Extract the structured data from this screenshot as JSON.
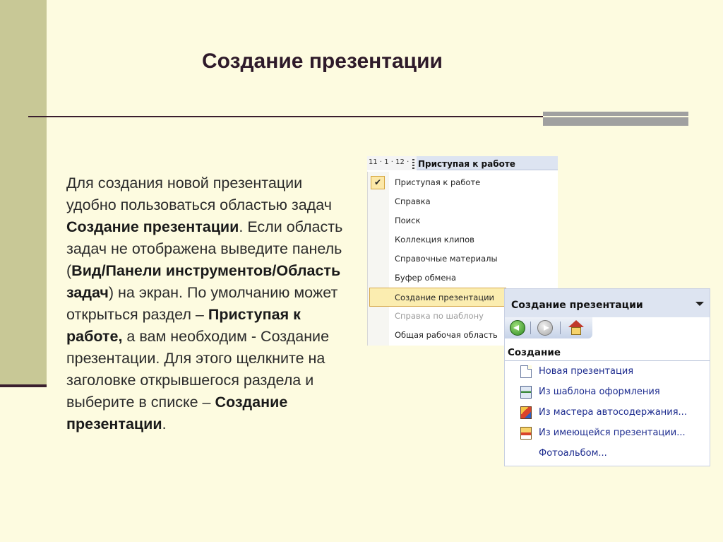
{
  "slide": {
    "title": "Создание презентации"
  },
  "body": {
    "p1": "Для создания новой презентации удобно пользоваться областью задач ",
    "b1": "Создание презентации",
    "p2": ". Если область задач не отображена выведите панель (",
    "b2": "Вид/Панели инструментов/Область задач",
    "p3": ") на экран. По умолчанию может открыться раздел – ",
    "b3": "Приступая к работе,",
    "p4": " а вам необходим - Создание презентации. Для этого щелкните на заголовке открывшегося раздела и выберите в списке – ",
    "b4": "Создание презентации",
    "p5": "."
  },
  "menu_shot": {
    "ruler": "11 · 1 · 12 ·",
    "header": "Приступая к работе",
    "items": [
      {
        "label": "Приступая к работе",
        "checked": true
      },
      {
        "label": "Справка"
      },
      {
        "label": "Поиск"
      },
      {
        "label": "Коллекция клипов"
      },
      {
        "label": "Справочные материалы"
      },
      {
        "label": "Буфер обмена"
      },
      {
        "label": "Создание презентации",
        "highlighted": true
      },
      {
        "label": "Справка по шаблону",
        "disabled": true
      },
      {
        "label": "Общая рабочая область"
      }
    ]
  },
  "task_pane": {
    "header": "Создание презентации",
    "section": "Создание",
    "items": [
      {
        "label": "Новая презентация",
        "icon": "blank-document-icon"
      },
      {
        "label": "Из шаблона оформления",
        "icon": "design-template-icon"
      },
      {
        "label": "Из мастера автосодержания...",
        "icon": "autocontent-wizard-icon"
      },
      {
        "label": "Из имеющейся презентации...",
        "icon": "existing-presentation-icon"
      },
      {
        "label": "Фотоальбом..."
      }
    ]
  }
}
